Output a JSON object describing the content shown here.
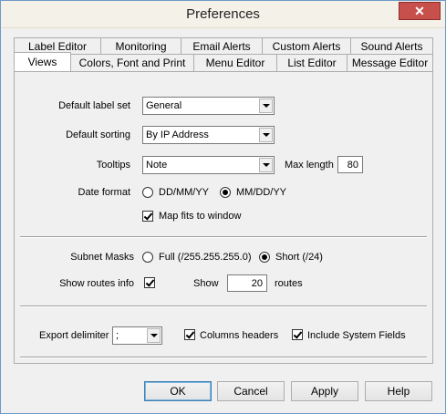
{
  "window": {
    "title": "Preferences",
    "close_glyph": "✕"
  },
  "tabs": {
    "back_row": [
      "Label Editor",
      "Monitoring",
      "Email Alerts",
      "Custom Alerts",
      "Sound Alerts"
    ],
    "front_row": [
      "Views",
      "Colors, Font and Print",
      "Menu Editor",
      "List Editor",
      "Message Editor"
    ],
    "active": "Views"
  },
  "views": {
    "default_label_set": {
      "label": "Default label set",
      "value": "General"
    },
    "default_sorting": {
      "label": "Default sorting",
      "value": "By IP Address"
    },
    "tooltips": {
      "label": "Tooltips",
      "value": "Note",
      "max_length_label": "Max length",
      "max_length_value": "80"
    },
    "date_format": {
      "label": "Date format",
      "option1": "DD/MM/YY",
      "option2": "MM/DD/YY",
      "selected": "MM/DD/YY"
    },
    "map_fits": {
      "label": "Map fits to window",
      "checked": true
    },
    "subnet_masks": {
      "label": "Subnet Masks",
      "option1": "Full (/255.255.255.0)",
      "option2": "Short (/24)",
      "selected": "Short (/24)"
    },
    "show_routes": {
      "label": "Show routes info",
      "checked": true,
      "show_label": "Show",
      "count": "20",
      "routes_label": "routes"
    },
    "export_delimiter": {
      "label": "Export delimiter",
      "value": ";"
    },
    "columns_headers": {
      "label": "Columns headers",
      "checked": true
    },
    "include_system_fields": {
      "label": "Include System Fields",
      "checked": true
    }
  },
  "buttons": {
    "ok": "OK",
    "cancel": "Cancel",
    "apply": "Apply",
    "help": "Help"
  }
}
